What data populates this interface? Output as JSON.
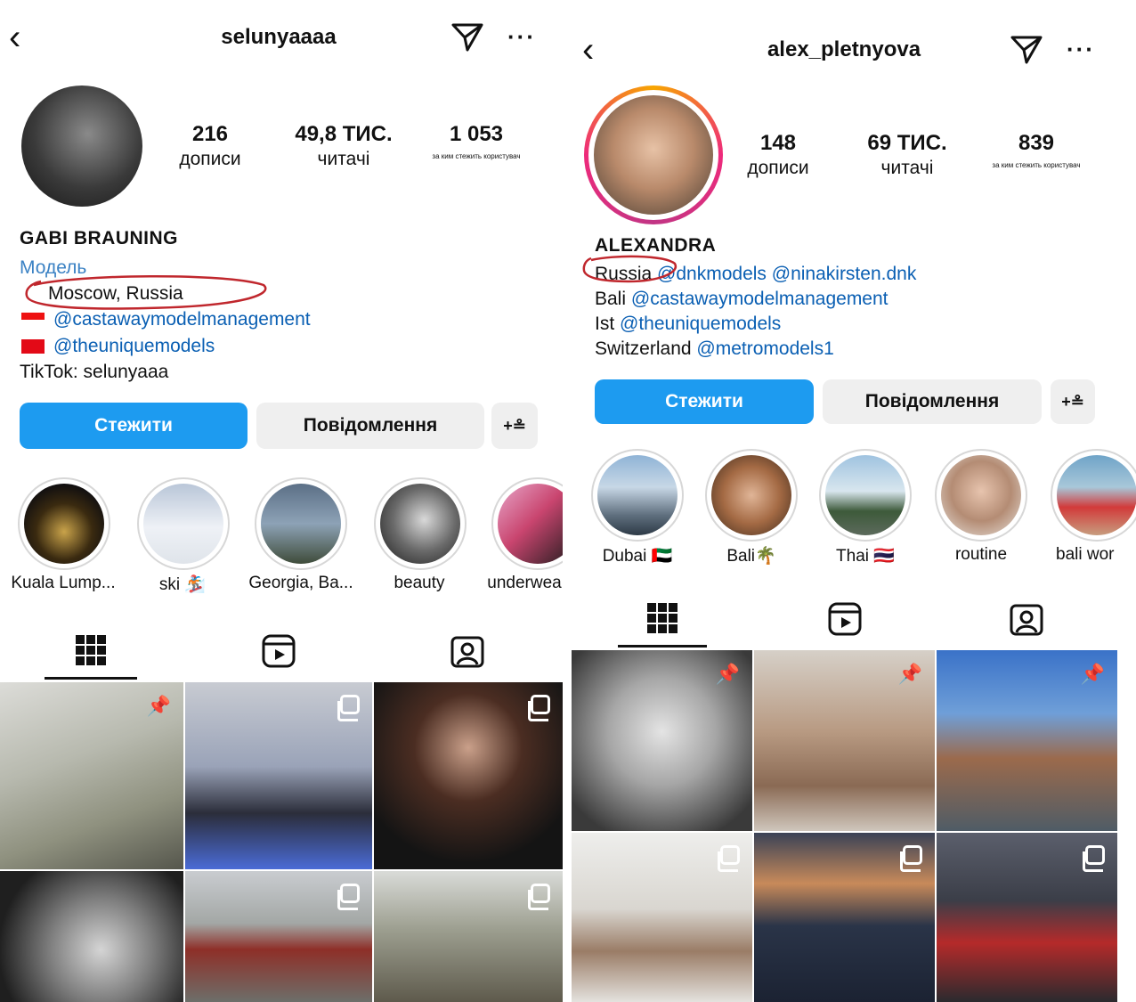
{
  "left": {
    "username": "selunyaaaa",
    "stats": [
      {
        "value": "216",
        "label": "дописи"
      },
      {
        "value": "49,8 ТИС.",
        "label": "читачі"
      },
      {
        "value": "1 053",
        "label": "за ким стежить користувач"
      }
    ],
    "name": "GABI BRAUNING",
    "category": "Модель",
    "bio": {
      "location": "Moscow, Russia",
      "agency1": "@castawaymodelmanagement",
      "agency2": "@theuniquemodels",
      "tiktok": "TikTok: selunyaaa"
    },
    "buttons": {
      "follow": "Стежити",
      "message": "Повідомлення",
      "add": "+≗"
    },
    "highlights": [
      {
        "label": "Kuala Lump..."
      },
      {
        "label": "ski 🏂"
      },
      {
        "label": "Georgia, Ba..."
      },
      {
        "label": "beauty"
      },
      {
        "label": "underwea"
      }
    ]
  },
  "right": {
    "username": "alex_pletnyova",
    "stats": [
      {
        "value": "148",
        "label": "дописи"
      },
      {
        "value": "69 ТИС.",
        "label": "читачі"
      },
      {
        "value": "839",
        "label": "за ким стежить користувач"
      }
    ],
    "name": "ALEXANDRA",
    "bio": {
      "line1_prefix": "Russia",
      "line1_links": "@dnkmodels @ninakirsten.dnk",
      "line2_prefix": "Bali",
      "line2_link": "@castawaymodelmanagement",
      "line3_prefix": "Ist",
      "line3_link": "@theuniquemodels",
      "line4_prefix": "Switzerland",
      "line4_link": "@metromodels1"
    },
    "buttons": {
      "follow": "Стежити",
      "message": "Повідомлення",
      "add": "+≗"
    },
    "highlights": [
      {
        "label": "Dubai 🇦🇪"
      },
      {
        "label": "Bali🌴"
      },
      {
        "label": "Thai 🇹🇭"
      },
      {
        "label": "routine"
      },
      {
        "label": "bali wor"
      }
    ]
  },
  "colors": {
    "follow": "#1d9bf0",
    "link": "#0a5fb3",
    "annotation": "#c0272d"
  }
}
